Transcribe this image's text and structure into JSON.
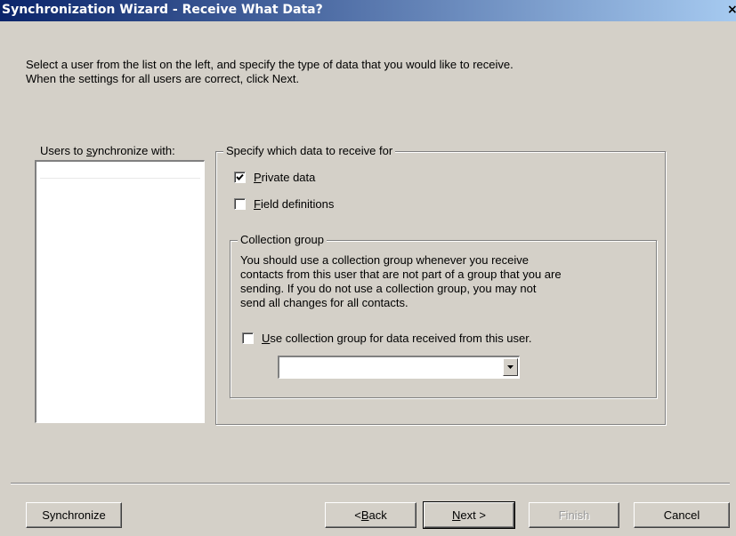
{
  "window": {
    "title": "Synchronization Wizard - Receive What Data?",
    "close_glyph": "×"
  },
  "instructions": {
    "line1": "Select a user from the list on the left, and specify the type of data that you would like to receive.",
    "line2": "When the settings for all users are correct, click Next."
  },
  "users": {
    "label_pre": "Users to ",
    "label_mnemonic": "s",
    "label_post": "ynchronize with:",
    "items": []
  },
  "receive_group": {
    "legend": "Specify which data to receive for",
    "private_data": {
      "mnemonic": "P",
      "rest": "rivate data",
      "checked": true
    },
    "field_definitions": {
      "mnemonic": "F",
      "rest": "ield definitions",
      "checked": false
    }
  },
  "collection_group": {
    "legend": "Collection group",
    "desc_line1": "You should use a collection group whenever you receive",
    "desc_line2": "contacts from this user that are not part of a group that you are",
    "desc_line3": "sending.  If you do not use a collection group, you may not",
    "desc_line4": "send all changes for all contacts.",
    "use_checkbox": {
      "mnemonic": "U",
      "rest": "se collection group for data received from this user.",
      "checked": false
    },
    "dropdown_value": ""
  },
  "buttons": {
    "synchronize": "Synchronize",
    "back_pre": "< ",
    "back_mnemonic": "B",
    "back_post": "ack",
    "next_mnemonic": "N",
    "next_post": "ext >",
    "finish": "Finish",
    "cancel": "Cancel"
  }
}
